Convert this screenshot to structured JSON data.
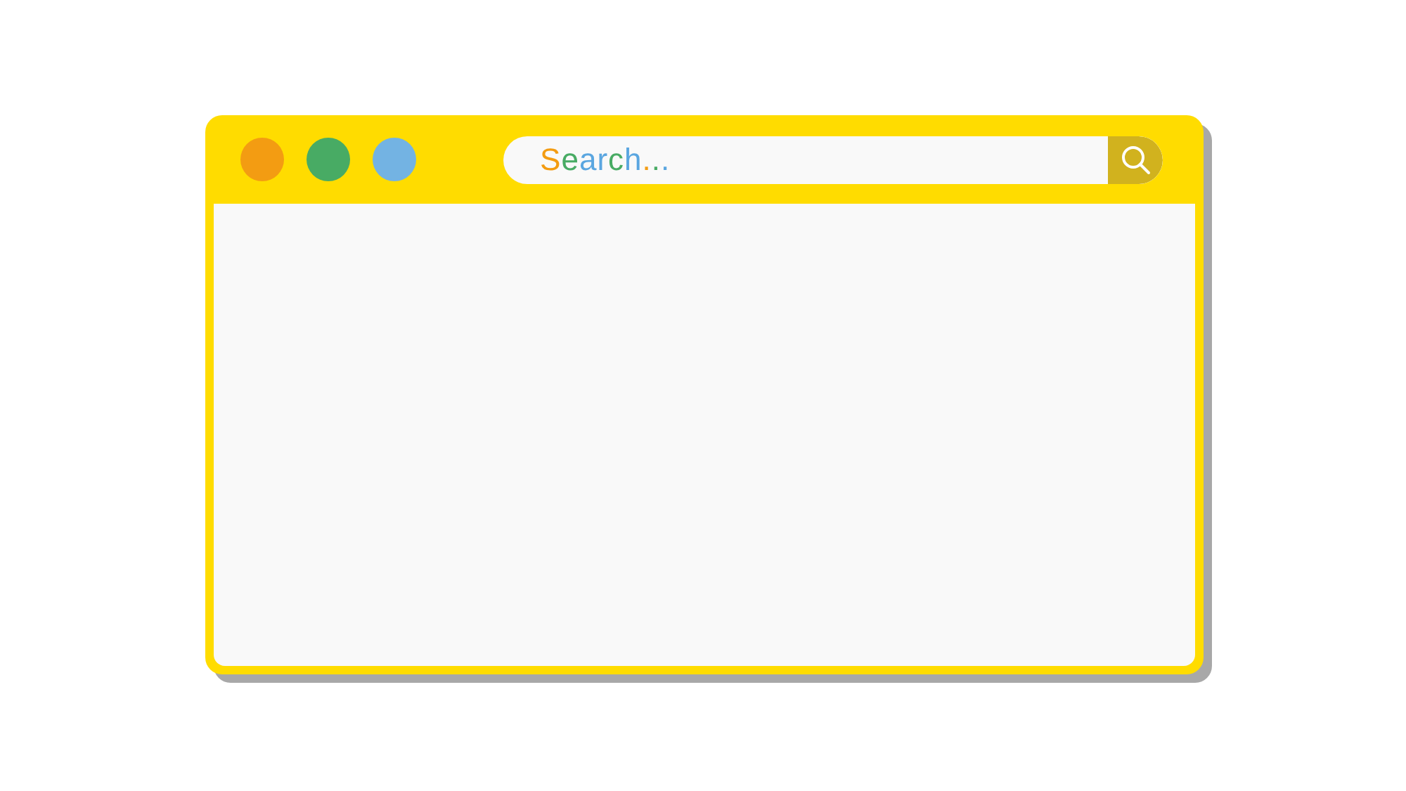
{
  "window": {
    "controls": [
      {
        "color": "#f39c12"
      },
      {
        "color": "#48ab64"
      },
      {
        "color": "#73b3e3"
      }
    ]
  },
  "search": {
    "placeholder": "Search...",
    "letters": [
      {
        "color": "#f39c12"
      },
      {
        "color": "#48ab64"
      },
      {
        "color": "#5aa6e0"
      },
      {
        "color": "#5aa6e0"
      },
      {
        "color": "#48ab64"
      },
      {
        "color": "#5aa6e0"
      },
      {
        "color": "#f39c12"
      },
      {
        "color": "#48ab64"
      },
      {
        "color": "#5aa6e0"
      }
    ]
  }
}
